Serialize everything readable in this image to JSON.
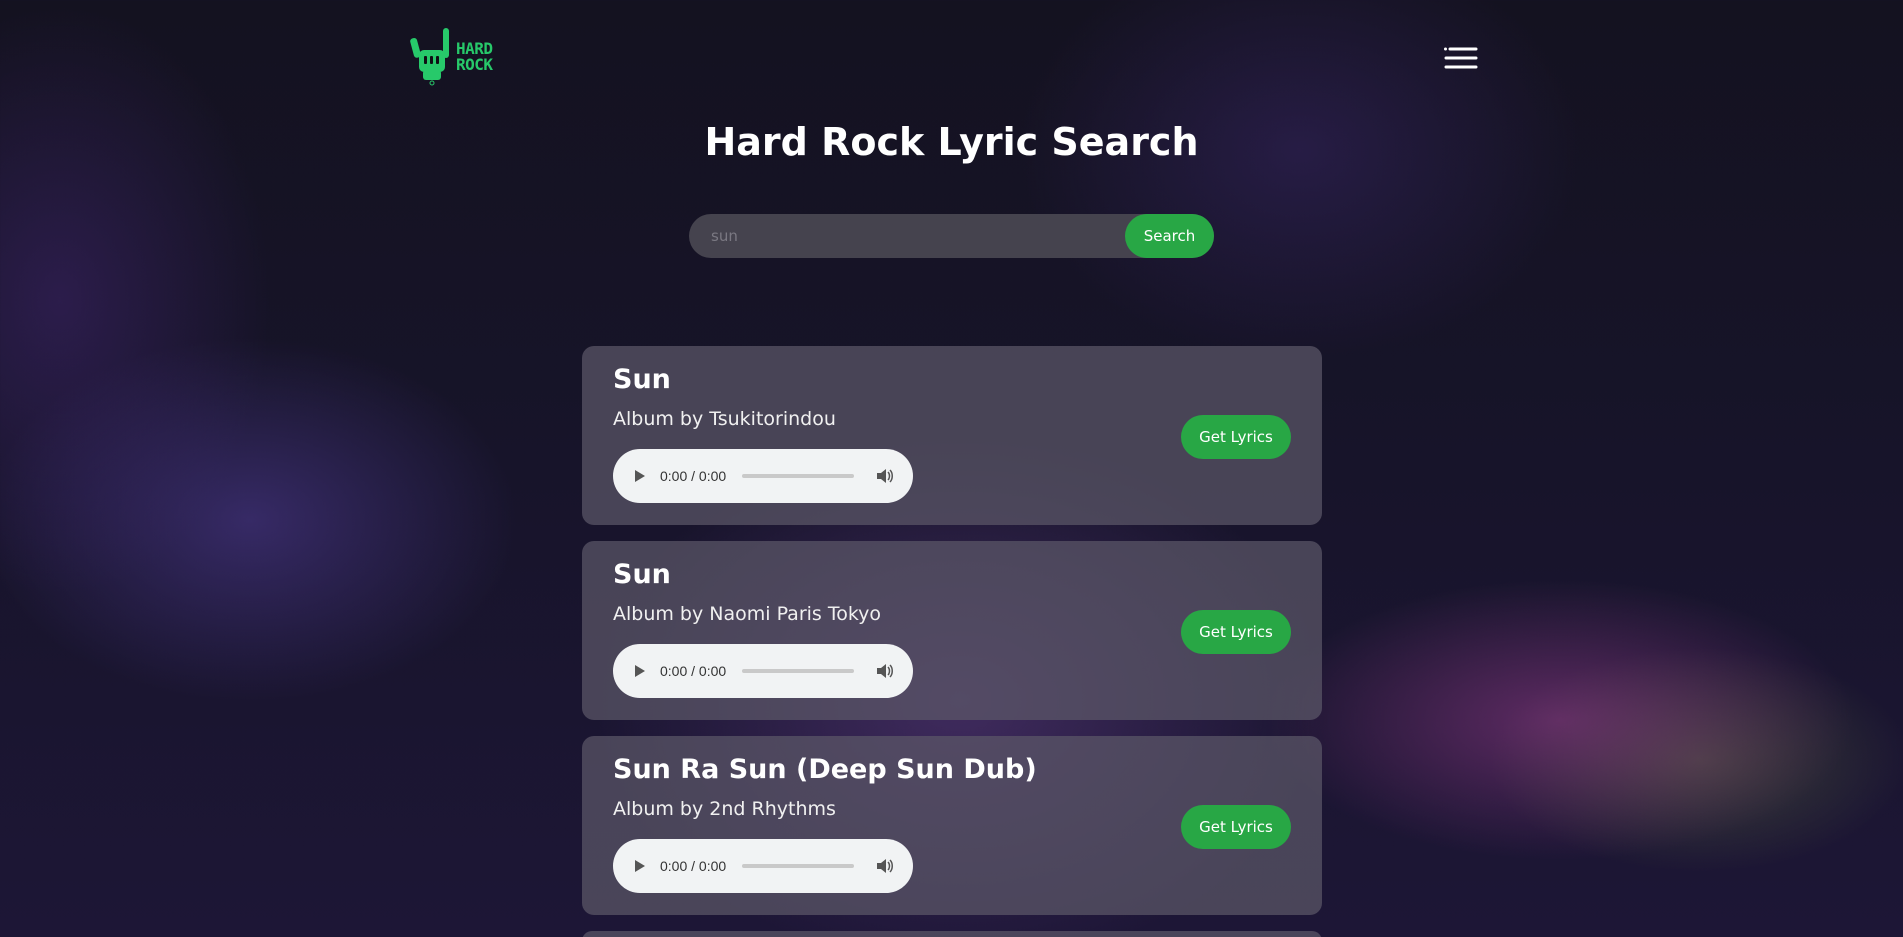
{
  "header": {
    "logo_text_line1": "HARD",
    "logo_text_line2": "ROCK",
    "menu_icon": "hamburger-menu-icon"
  },
  "page": {
    "title": "Hard Rock Lyric Search"
  },
  "search": {
    "value": "",
    "placeholder": "sun",
    "button_label": "Search"
  },
  "results": [
    {
      "title": "Sun",
      "artist_line": "Album by Tsukitorindou",
      "player_time": "0:00 / 0:00",
      "button_label": "Get Lyrics"
    },
    {
      "title": "Sun",
      "artist_line": "Album by Naomi Paris Tokyo",
      "player_time": "0:00 / 0:00",
      "button_label": "Get Lyrics"
    },
    {
      "title": "Sun Ra Sun (Deep Sun Dub)",
      "artist_line": "Album by 2nd Rhythms",
      "player_time": "0:00 / 0:00",
      "button_label": "Get Lyrics"
    }
  ],
  "colors": {
    "accent": "#28a745",
    "logo": "#27c96a"
  }
}
